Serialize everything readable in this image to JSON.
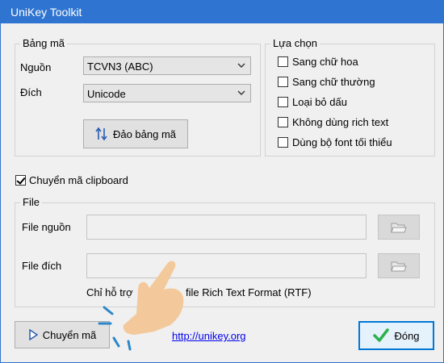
{
  "window": {
    "title": "UniKey Toolkit"
  },
  "bang_ma": {
    "legend": "Bảng mã",
    "source_label": "Nguồn",
    "source_value": "TCVN3 (ABC)",
    "target_label": "Đích",
    "target_value": "Unicode",
    "swap_button": "Đảo bảng mã"
  },
  "lua_chon": {
    "legend": "Lựa chọn",
    "options": [
      {
        "label": "Sang chữ hoa",
        "checked": false
      },
      {
        "label": "Sang chữ thường",
        "checked": false
      },
      {
        "label": "Loại bỏ dấu",
        "checked": false
      },
      {
        "label": "Không dùng rich text",
        "checked": false
      },
      {
        "label": "Dùng bộ font tối thiểu",
        "checked": false
      }
    ]
  },
  "clipboard": {
    "label": "Chuyển mã clipboard",
    "checked": true
  },
  "file": {
    "legend": "File",
    "source_label": "File nguồn",
    "target_label": "File đích",
    "note_start": "Chỉ hỗ trợ",
    "note_end": "file Rich Text Format (RTF)"
  },
  "bottom": {
    "convert_button": "Chuyển mã",
    "link": "http://unikey.org",
    "close_button": "Đóng"
  },
  "colors": {
    "title_bar": "#2f74d0",
    "accent": "#0078d7",
    "ok_check": "#2bb24c"
  },
  "icons": [
    "swap-icon",
    "chevron-down-icon",
    "folder-icon",
    "play-icon",
    "checkmark-icon",
    "pointing-hand-icon"
  ]
}
